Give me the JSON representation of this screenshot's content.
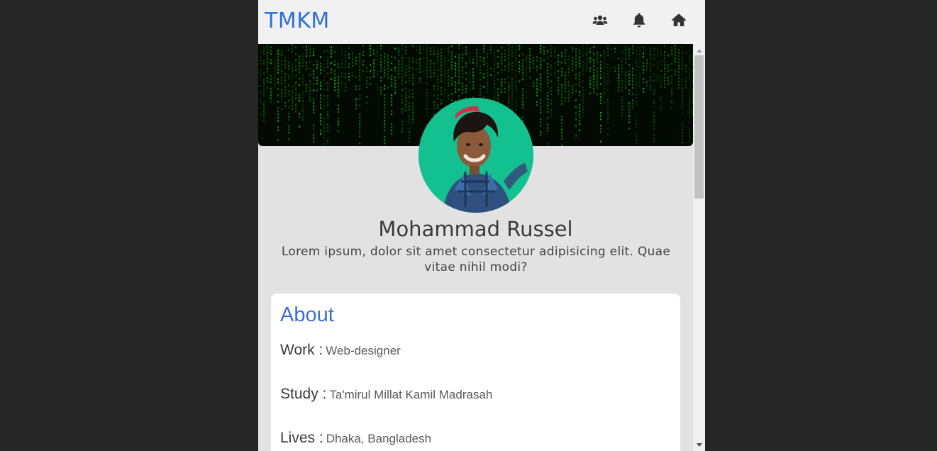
{
  "header": {
    "brand": "TMKM",
    "icons": [
      "users-icon",
      "bell-icon",
      "home-icon"
    ]
  },
  "profile": {
    "name": "Mohammad Russel",
    "bio": "Lorem ipsum, dolor sit amet consectetur adipisicing elit. Quae vitae nihil modi?"
  },
  "about": {
    "title": "About",
    "rows": [
      {
        "key": "Work :",
        "value": "Web-designer"
      },
      {
        "key": "Study :",
        "value": "Ta'mirul Millat Kamil Madrasah"
      },
      {
        "key": "Lives :",
        "value": "Dhaka, Bangladesh"
      }
    ]
  },
  "colors": {
    "brand": "#2f6fdc",
    "about_title": "#3d6fd0",
    "avatar_bg": "#12c18f",
    "cover_code": "#16c416"
  }
}
